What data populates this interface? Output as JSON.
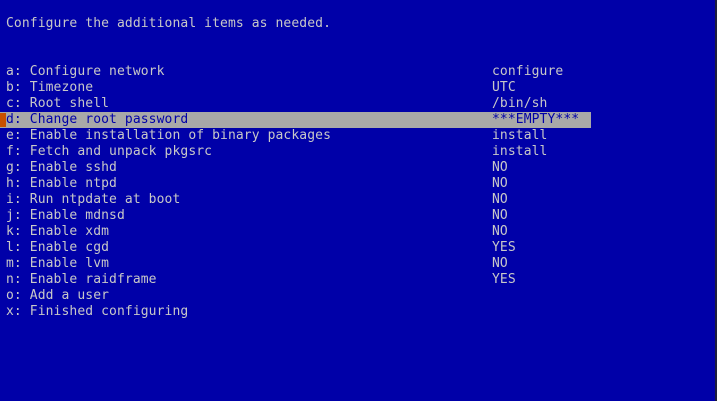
{
  "header": {
    "text": "Configure the additional items as needed."
  },
  "colors": {
    "background": "#0000a8",
    "text": "#c8c8c8",
    "highlight": "#a8a8a8",
    "cursor": "#c85000"
  },
  "menu": {
    "selected_index": 3,
    "items": [
      {
        "key": "a",
        "label": "a: Configure network",
        "value": "configure"
      },
      {
        "key": "b",
        "label": "b: Timezone",
        "value": "UTC"
      },
      {
        "key": "c",
        "label": "c: Root shell",
        "value": "/bin/sh"
      },
      {
        "key": "d",
        "label": "d: Change root password",
        "value": "***EMPTY***"
      },
      {
        "key": "e",
        "label": "e: Enable installation of binary packages",
        "value": "install"
      },
      {
        "key": "f",
        "label": "f: Fetch and unpack pkgsrc",
        "value": "install"
      },
      {
        "key": "g",
        "label": "g: Enable sshd",
        "value": "NO"
      },
      {
        "key": "h",
        "label": "h: Enable ntpd",
        "value": "NO"
      },
      {
        "key": "i",
        "label": "i: Run ntpdate at boot",
        "value": "NO"
      },
      {
        "key": "j",
        "label": "j: Enable mdnsd",
        "value": "NO"
      },
      {
        "key": "k",
        "label": "k: Enable xdm",
        "value": "NO"
      },
      {
        "key": "l",
        "label": "l: Enable cgd",
        "value": "YES"
      },
      {
        "key": "m",
        "label": "m: Enable lvm",
        "value": "NO"
      },
      {
        "key": "n",
        "label": "n: Enable raidframe",
        "value": "YES"
      },
      {
        "key": "o",
        "label": "o: Add a user",
        "value": ""
      },
      {
        "key": "x",
        "label": "x: Finished configuring",
        "value": ""
      }
    ]
  }
}
